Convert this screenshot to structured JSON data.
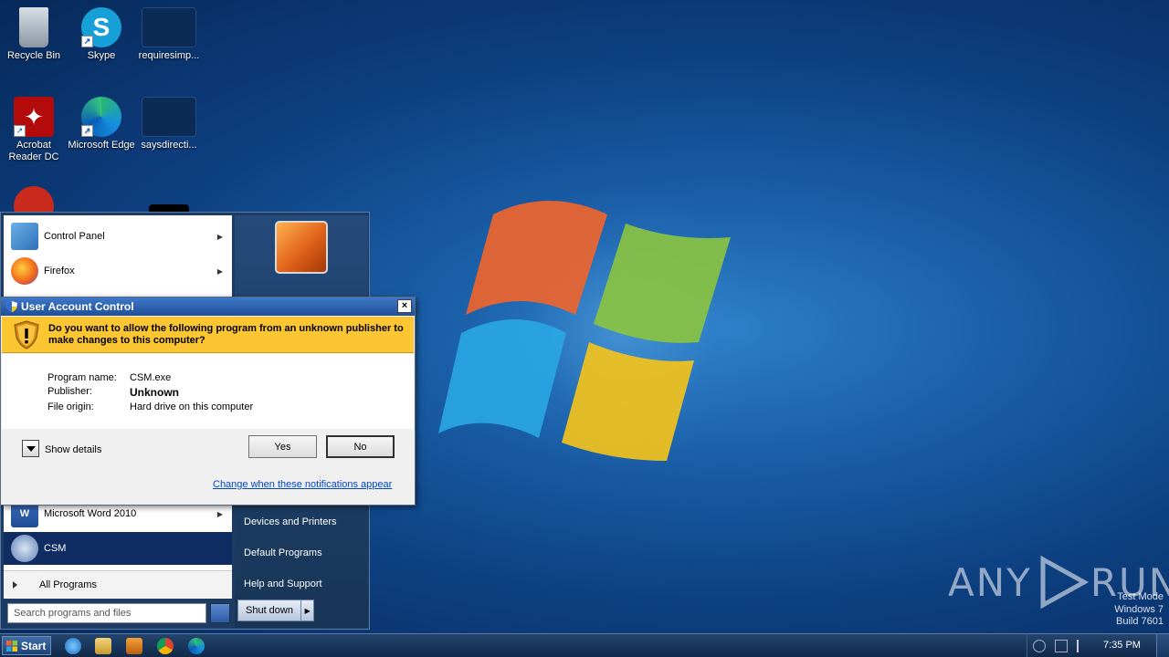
{
  "desktop": {
    "icons": [
      {
        "label": "Recycle Bin",
        "icon": "recycle-bin-icon"
      },
      {
        "label": "Skype",
        "icon": "skype-icon"
      },
      {
        "label": "requiresimp...",
        "icon": "file-icon"
      },
      {
        "label": "Acrobat Reader DC",
        "icon": "acrobat-icon"
      },
      {
        "label": "Microsoft Edge",
        "icon": "edge-icon"
      },
      {
        "label": "saysdirecti...",
        "icon": "file-icon"
      }
    ]
  },
  "start_menu": {
    "left_items": [
      {
        "label": "Control Panel",
        "has_submenu": true
      },
      {
        "label": "Firefox",
        "has_submenu": true
      },
      {
        "label": "Microsoft Word 2010",
        "has_submenu": true
      },
      {
        "label": "CSM",
        "has_submenu": false
      }
    ],
    "all_programs": "All Programs",
    "search_placeholder": "Search programs and files",
    "right_items": [
      "Devices and Printers",
      "Default Programs",
      "Help and Support"
    ],
    "shutdown_label": "Shut down"
  },
  "uac": {
    "title": "User Account Control",
    "question": "Do you want to allow the following program from an unknown publisher to make changes to this computer?",
    "fields": [
      {
        "key": "Program name:",
        "value": "CSM.exe"
      },
      {
        "key": "Publisher:",
        "value": "Unknown"
      },
      {
        "key": "File origin:",
        "value": "Hard drive on this computer"
      }
    ],
    "show_details": "Show details",
    "yes": "Yes",
    "no": "No",
    "link": "Change when these notifications appear",
    "close_glyph": "×"
  },
  "watermark": {
    "brand_left": "ANY",
    "brand_right": "RUN",
    "test_mode": [
      "Test Mode",
      "Windows 7",
      "Build 7601"
    ]
  },
  "taskbar": {
    "start_label": "Start",
    "pinned": [
      "ie-icon",
      "explorer-icon",
      "media-player-icon",
      "chrome-icon",
      "edge-icon"
    ],
    "clock": "7:35 PM"
  },
  "colors": {
    "uac_banner": "#fcc633",
    "title_bar": "#2a63b3",
    "link": "#0046c8",
    "start_selected": "#0f2d63"
  }
}
